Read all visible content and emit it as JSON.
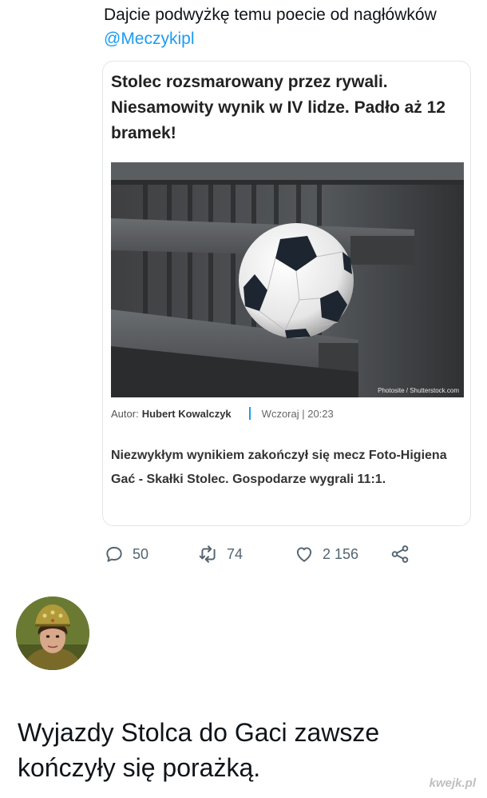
{
  "tweet": {
    "text": "Dajcie podwyżkę temu poecie od nagłówków ",
    "mention": "@Meczykipl"
  },
  "quote": {
    "headline": "Stolec rozsmarowany przez rywali. Niesamowity wynik w IV lidze. Padło aż 12 bramek!",
    "photo_credit": "Photosite / Shutterstock.com",
    "author_label": "Autor:",
    "author_name": "Hubert Kowalczyk",
    "time": "Wczoraj | 20:23",
    "lead": "Niezwykłym wynikiem zakończył się mecz Foto-Higiena Gać - Skałki Stolec. Gospodarze wygrali 11:1."
  },
  "actions": {
    "replies": "50",
    "retweets": "74",
    "likes": "2 156",
    "icons": [
      "reply-icon",
      "retweet-icon",
      "like-icon",
      "share-icon"
    ]
  },
  "reply": {
    "text": "Wyjazdy Stolca do Gaci zawsze kończyły się porażką."
  },
  "watermark": "kwejk.pl",
  "colors": {
    "link": "#1d9bf0",
    "meta": "#536471",
    "text": "#0f1419"
  }
}
